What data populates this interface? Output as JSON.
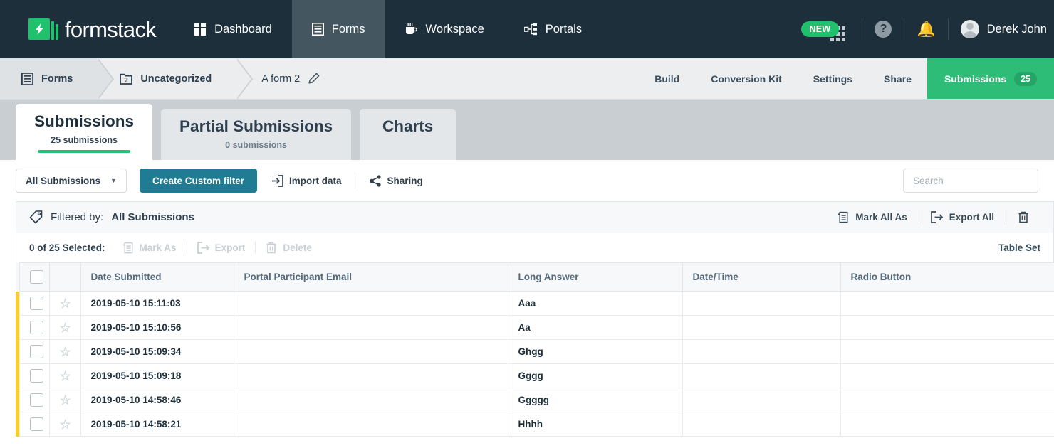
{
  "brand": {
    "name": "formstack"
  },
  "topnav": {
    "items": [
      {
        "label": "Dashboard",
        "icon": "dashboard-icon",
        "active": false
      },
      {
        "label": "Forms",
        "icon": "forms-icon",
        "active": true
      },
      {
        "label": "Workspace",
        "icon": "workspace-icon",
        "active": false
      },
      {
        "label": "Portals",
        "icon": "portals-icon",
        "active": false
      }
    ],
    "new_badge": "NEW",
    "help_icon": "?",
    "username": "Derek John"
  },
  "breadcrumb": {
    "items": [
      {
        "label": "Forms",
        "icon": "forms-icon"
      },
      {
        "label": "Uncategorized",
        "icon": "folder-question-icon"
      },
      {
        "label": "A form 2",
        "icon": "pencil-edit-icon"
      }
    ],
    "form_tabs": [
      {
        "label": "Build",
        "active": false
      },
      {
        "label": "Conversion Kit",
        "active": false
      },
      {
        "label": "Settings",
        "active": false
      },
      {
        "label": "Share",
        "active": false
      }
    ],
    "submissions_tab": {
      "label": "Submissions",
      "count": "25"
    }
  },
  "section_tabs": [
    {
      "title": "Submissions",
      "sub": "25 submissions",
      "active": true
    },
    {
      "title": "Partial Submissions",
      "sub": "0 submissions",
      "active": false
    },
    {
      "title": "Charts",
      "sub": "",
      "active": false
    }
  ],
  "toolbar": {
    "filter_select": "All Submissions",
    "create_filter_label": "Create Custom filter",
    "import_label": "Import data",
    "sharing_label": "Sharing",
    "search_placeholder": "Search",
    "search_value": ""
  },
  "filterbar": {
    "prefix": "Filtered by:",
    "value": "All Submissions",
    "mark_all_label": "Mark All As",
    "export_all_label": "Export All"
  },
  "selectionbar": {
    "count_label": "0 of 25 Selected:",
    "mark_as_label": "Mark As",
    "export_label": "Export",
    "delete_label": "Delete",
    "table_settings_label": "Table Set"
  },
  "table": {
    "columns": [
      "Date Submitted",
      "Portal Participant Email",
      "Long Answer",
      "Date/Time",
      "Radio Button"
    ],
    "rows": [
      {
        "date": "2019-05-10 15:11:03",
        "email": "",
        "long": "Aaa",
        "datetime": "",
        "radio": ""
      },
      {
        "date": "2019-05-10 15:10:56",
        "email": "",
        "long": "Aa",
        "datetime": "",
        "radio": ""
      },
      {
        "date": "2019-05-10 15:09:34",
        "email": "",
        "long": "Ghgg",
        "datetime": "",
        "radio": ""
      },
      {
        "date": "2019-05-10 15:09:18",
        "email": "",
        "long": "Gggg",
        "datetime": "",
        "radio": ""
      },
      {
        "date": "2019-05-10 14:58:46",
        "email": "",
        "long": "Ggggg",
        "datetime": "",
        "radio": ""
      },
      {
        "date": "2019-05-10 14:58:21",
        "email": "",
        "long": "Hhhh",
        "datetime": "",
        "radio": ""
      }
    ]
  },
  "colors": {
    "navy": "#1e2f3c",
    "green": "#2ebd77",
    "teal": "#1f7c92",
    "row_accent": "#fbce2b"
  }
}
